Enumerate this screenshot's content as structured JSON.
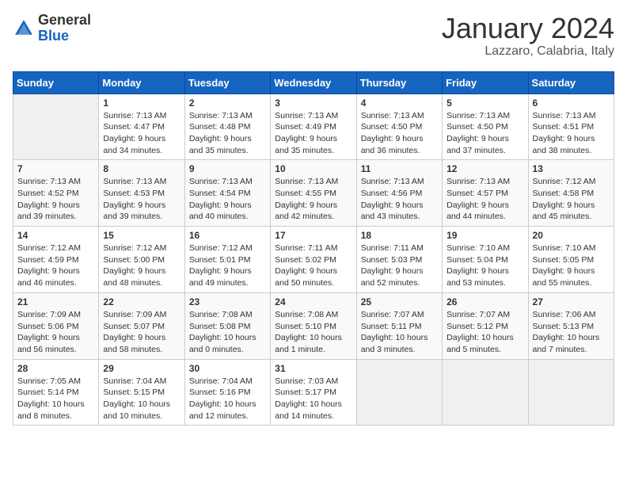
{
  "logo": {
    "general": "General",
    "blue": "Blue"
  },
  "header": {
    "title": "January 2024",
    "subtitle": "Lazzaro, Calabria, Italy"
  },
  "weekdays": [
    "Sunday",
    "Monday",
    "Tuesday",
    "Wednesday",
    "Thursday",
    "Friday",
    "Saturday"
  ],
  "weeks": [
    [
      {
        "day": "",
        "sunrise": "",
        "sunset": "",
        "daylight": ""
      },
      {
        "day": "1",
        "sunrise": "Sunrise: 7:13 AM",
        "sunset": "Sunset: 4:47 PM",
        "daylight": "Daylight: 9 hours and 34 minutes."
      },
      {
        "day": "2",
        "sunrise": "Sunrise: 7:13 AM",
        "sunset": "Sunset: 4:48 PM",
        "daylight": "Daylight: 9 hours and 35 minutes."
      },
      {
        "day": "3",
        "sunrise": "Sunrise: 7:13 AM",
        "sunset": "Sunset: 4:49 PM",
        "daylight": "Daylight: 9 hours and 35 minutes."
      },
      {
        "day": "4",
        "sunrise": "Sunrise: 7:13 AM",
        "sunset": "Sunset: 4:50 PM",
        "daylight": "Daylight: 9 hours and 36 minutes."
      },
      {
        "day": "5",
        "sunrise": "Sunrise: 7:13 AM",
        "sunset": "Sunset: 4:50 PM",
        "daylight": "Daylight: 9 hours and 37 minutes."
      },
      {
        "day": "6",
        "sunrise": "Sunrise: 7:13 AM",
        "sunset": "Sunset: 4:51 PM",
        "daylight": "Daylight: 9 hours and 38 minutes."
      }
    ],
    [
      {
        "day": "7",
        "sunrise": "Sunrise: 7:13 AM",
        "sunset": "Sunset: 4:52 PM",
        "daylight": "Daylight: 9 hours and 39 minutes."
      },
      {
        "day": "8",
        "sunrise": "Sunrise: 7:13 AM",
        "sunset": "Sunset: 4:53 PM",
        "daylight": "Daylight: 9 hours and 39 minutes."
      },
      {
        "day": "9",
        "sunrise": "Sunrise: 7:13 AM",
        "sunset": "Sunset: 4:54 PM",
        "daylight": "Daylight: 9 hours and 40 minutes."
      },
      {
        "day": "10",
        "sunrise": "Sunrise: 7:13 AM",
        "sunset": "Sunset: 4:55 PM",
        "daylight": "Daylight: 9 hours and 42 minutes."
      },
      {
        "day": "11",
        "sunrise": "Sunrise: 7:13 AM",
        "sunset": "Sunset: 4:56 PM",
        "daylight": "Daylight: 9 hours and 43 minutes."
      },
      {
        "day": "12",
        "sunrise": "Sunrise: 7:13 AM",
        "sunset": "Sunset: 4:57 PM",
        "daylight": "Daylight: 9 hours and 44 minutes."
      },
      {
        "day": "13",
        "sunrise": "Sunrise: 7:12 AM",
        "sunset": "Sunset: 4:58 PM",
        "daylight": "Daylight: 9 hours and 45 minutes."
      }
    ],
    [
      {
        "day": "14",
        "sunrise": "Sunrise: 7:12 AM",
        "sunset": "Sunset: 4:59 PM",
        "daylight": "Daylight: 9 hours and 46 minutes."
      },
      {
        "day": "15",
        "sunrise": "Sunrise: 7:12 AM",
        "sunset": "Sunset: 5:00 PM",
        "daylight": "Daylight: 9 hours and 48 minutes."
      },
      {
        "day": "16",
        "sunrise": "Sunrise: 7:12 AM",
        "sunset": "Sunset: 5:01 PM",
        "daylight": "Daylight: 9 hours and 49 minutes."
      },
      {
        "day": "17",
        "sunrise": "Sunrise: 7:11 AM",
        "sunset": "Sunset: 5:02 PM",
        "daylight": "Daylight: 9 hours and 50 minutes."
      },
      {
        "day": "18",
        "sunrise": "Sunrise: 7:11 AM",
        "sunset": "Sunset: 5:03 PM",
        "daylight": "Daylight: 9 hours and 52 minutes."
      },
      {
        "day": "19",
        "sunrise": "Sunrise: 7:10 AM",
        "sunset": "Sunset: 5:04 PM",
        "daylight": "Daylight: 9 hours and 53 minutes."
      },
      {
        "day": "20",
        "sunrise": "Sunrise: 7:10 AM",
        "sunset": "Sunset: 5:05 PM",
        "daylight": "Daylight: 9 hours and 55 minutes."
      }
    ],
    [
      {
        "day": "21",
        "sunrise": "Sunrise: 7:09 AM",
        "sunset": "Sunset: 5:06 PM",
        "daylight": "Daylight: 9 hours and 56 minutes."
      },
      {
        "day": "22",
        "sunrise": "Sunrise: 7:09 AM",
        "sunset": "Sunset: 5:07 PM",
        "daylight": "Daylight: 9 hours and 58 minutes."
      },
      {
        "day": "23",
        "sunrise": "Sunrise: 7:08 AM",
        "sunset": "Sunset: 5:08 PM",
        "daylight": "Daylight: 10 hours and 0 minutes."
      },
      {
        "day": "24",
        "sunrise": "Sunrise: 7:08 AM",
        "sunset": "Sunset: 5:10 PM",
        "daylight": "Daylight: 10 hours and 1 minute."
      },
      {
        "day": "25",
        "sunrise": "Sunrise: 7:07 AM",
        "sunset": "Sunset: 5:11 PM",
        "daylight": "Daylight: 10 hours and 3 minutes."
      },
      {
        "day": "26",
        "sunrise": "Sunrise: 7:07 AM",
        "sunset": "Sunset: 5:12 PM",
        "daylight": "Daylight: 10 hours and 5 minutes."
      },
      {
        "day": "27",
        "sunrise": "Sunrise: 7:06 AM",
        "sunset": "Sunset: 5:13 PM",
        "daylight": "Daylight: 10 hours and 7 minutes."
      }
    ],
    [
      {
        "day": "28",
        "sunrise": "Sunrise: 7:05 AM",
        "sunset": "Sunset: 5:14 PM",
        "daylight": "Daylight: 10 hours and 8 minutes."
      },
      {
        "day": "29",
        "sunrise": "Sunrise: 7:04 AM",
        "sunset": "Sunset: 5:15 PM",
        "daylight": "Daylight: 10 hours and 10 minutes."
      },
      {
        "day": "30",
        "sunrise": "Sunrise: 7:04 AM",
        "sunset": "Sunset: 5:16 PM",
        "daylight": "Daylight: 10 hours and 12 minutes."
      },
      {
        "day": "31",
        "sunrise": "Sunrise: 7:03 AM",
        "sunset": "Sunset: 5:17 PM",
        "daylight": "Daylight: 10 hours and 14 minutes."
      },
      {
        "day": "",
        "sunrise": "",
        "sunset": "",
        "daylight": ""
      },
      {
        "day": "",
        "sunrise": "",
        "sunset": "",
        "daylight": ""
      },
      {
        "day": "",
        "sunrise": "",
        "sunset": "",
        "daylight": ""
      }
    ]
  ]
}
